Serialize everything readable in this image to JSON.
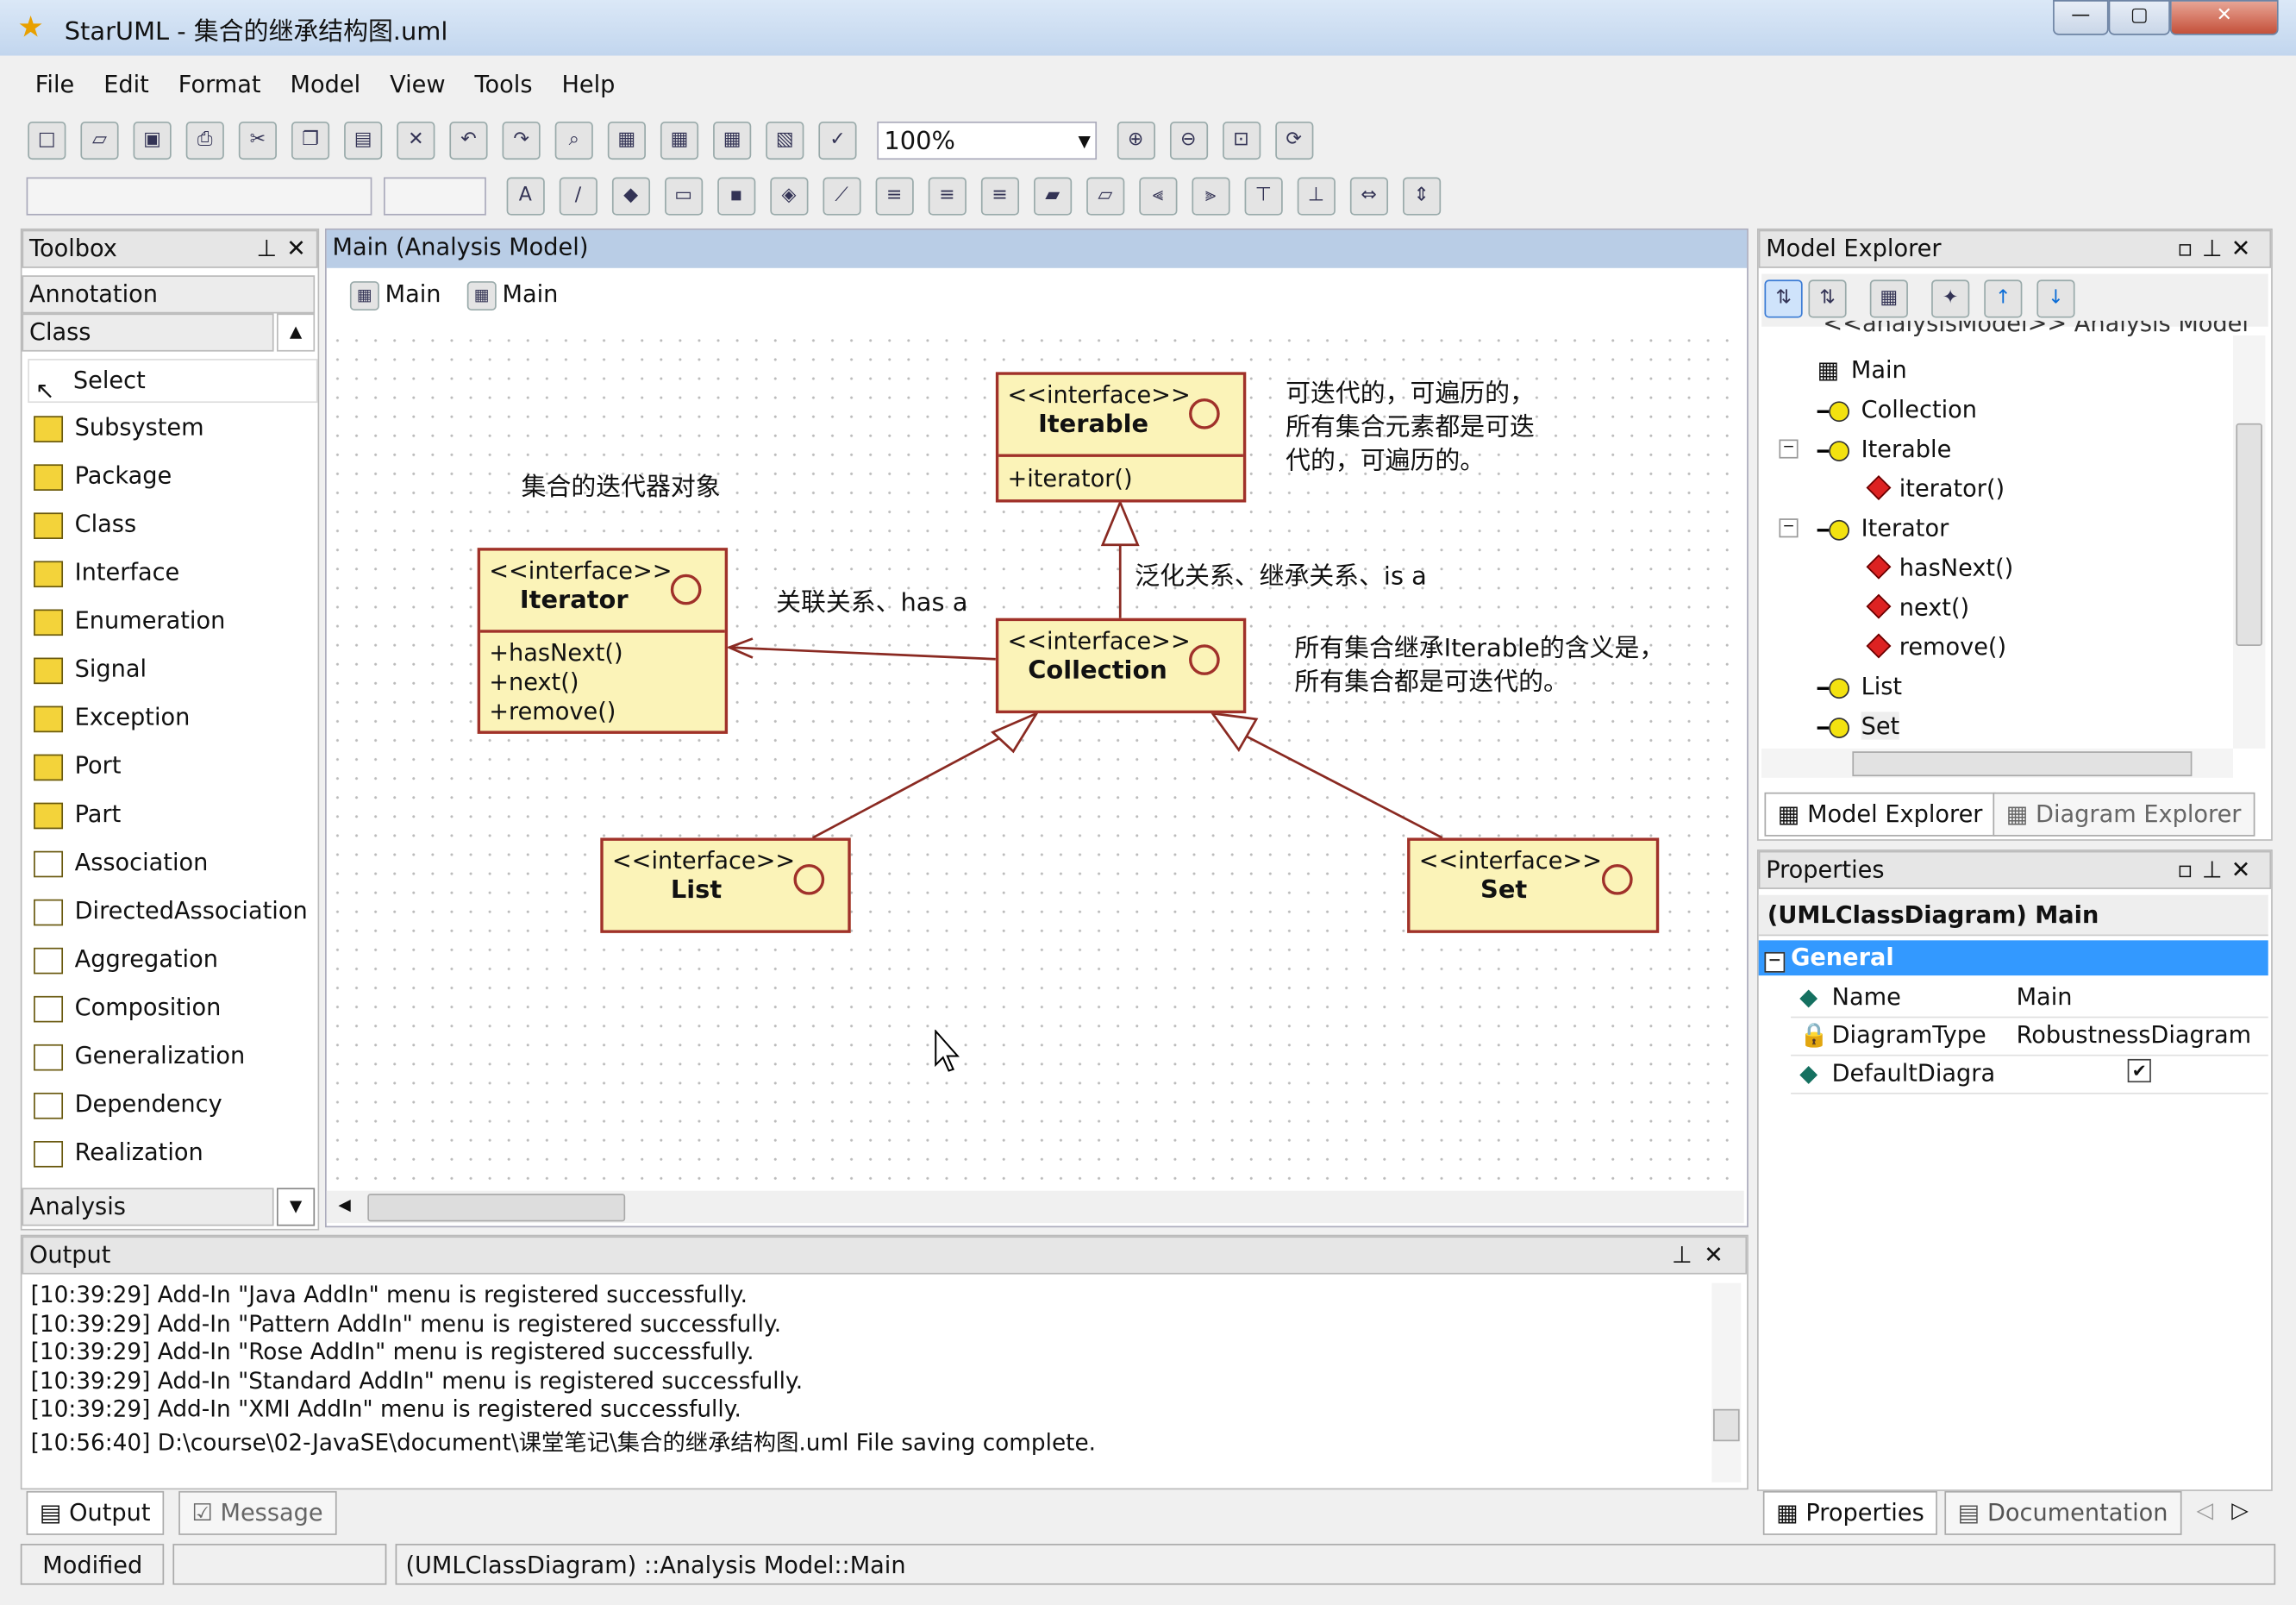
{
  "window": {
    "title": "StarUML - 集合的继承结构图.uml",
    "minimize": "—",
    "maximize": "▢",
    "close": "✕"
  },
  "menu": [
    "File",
    "Edit",
    "Format",
    "Model",
    "View",
    "Tools",
    "Help"
  ],
  "toolbar": {
    "zoom": "100%"
  },
  "toolbox": {
    "title": "Toolbox",
    "sections": [
      "Annotation",
      "Class"
    ],
    "items": [
      "Select",
      "Subsystem",
      "Package",
      "Class",
      "Interface",
      "Enumeration",
      "Signal",
      "Exception",
      "Port",
      "Part",
      "Association",
      "DirectedAssociation",
      "Aggregation",
      "Composition",
      "Generalization",
      "Dependency",
      "Realization"
    ],
    "footer": "Analysis"
  },
  "diagram": {
    "title": "Main (Analysis Model)",
    "tabs": [
      "Main",
      "Main"
    ],
    "classes": {
      "iterable": {
        "stereotype": "<<interface>>",
        "name": "Iterable",
        "ops": [
          "+iterator()"
        ]
      },
      "iterator": {
        "stereotype": "<<interface>>",
        "name": "Iterator",
        "ops": [
          "+hasNext()",
          "+next()",
          "+remove()"
        ]
      },
      "collection": {
        "stereotype": "<<interface>>",
        "name": "Collection"
      },
      "list": {
        "stereotype": "<<interface>>",
        "name": "List"
      },
      "set": {
        "stereotype": "<<interface>>",
        "name": "Set"
      }
    },
    "notes": {
      "iterator_note": "集合的迭代器对象",
      "assoc": "关联关系、has a",
      "gen": "泛化关系、继承关系、is a",
      "iterable_note": [
        "可迭代的，可遍历的，",
        "所有集合元素都是可迭",
        "代的，可遍历的。"
      ],
      "collection_note": [
        "所有集合继承Iterable的含义是，",
        "所有集合都是可迭代的。"
      ]
    }
  },
  "explorer": {
    "title": "Model Explorer",
    "root": "<<analysisModel>> Analysis Model",
    "items": [
      "Main",
      "Collection",
      "Iterable",
      "iterator()",
      "Iterator",
      "hasNext()",
      "next()",
      "remove()",
      "List",
      "Set"
    ],
    "tabs": [
      "Model Explorer",
      "Diagram Explorer"
    ]
  },
  "properties": {
    "title": "Properties",
    "header": "(UMLClassDiagram) Main",
    "group": "General",
    "rows": [
      {
        "name": "Name",
        "value": "Main"
      },
      {
        "name": "DiagramType",
        "value": "RobustnessDiagram"
      },
      {
        "name": "DefaultDiagra",
        "value": "✔"
      }
    ],
    "tabs": [
      "Properties",
      "Documentation"
    ]
  },
  "output": {
    "title": "Output",
    "lines": [
      "[10:39:29]  Add-In \"Java AddIn\" menu is registered successfully.",
      "[10:39:29]  Add-In \"Pattern AddIn\" menu is registered successfully.",
      "[10:39:29]  Add-In \"Rose AddIn\" menu is registered successfully.",
      "[10:39:29]  Add-In \"Standard AddIn\" menu is registered successfully.",
      "[10:39:29]  Add-In \"XMI AddIn\" menu is registered successfully.",
      "[10:56:40]  D:\\course\\02-JavaSE\\document\\课堂笔记\\集合的继承结构图.uml File saving complete."
    ],
    "tabs": [
      "Output",
      "Message"
    ]
  },
  "status": {
    "state": "Modified",
    "path": "(UMLClassDiagram) ::Analysis Model::Main"
  },
  "colors": {
    "class_fill": "#fbf3b8",
    "class_border": "#a0312a",
    "selection": "#3399ff"
  }
}
